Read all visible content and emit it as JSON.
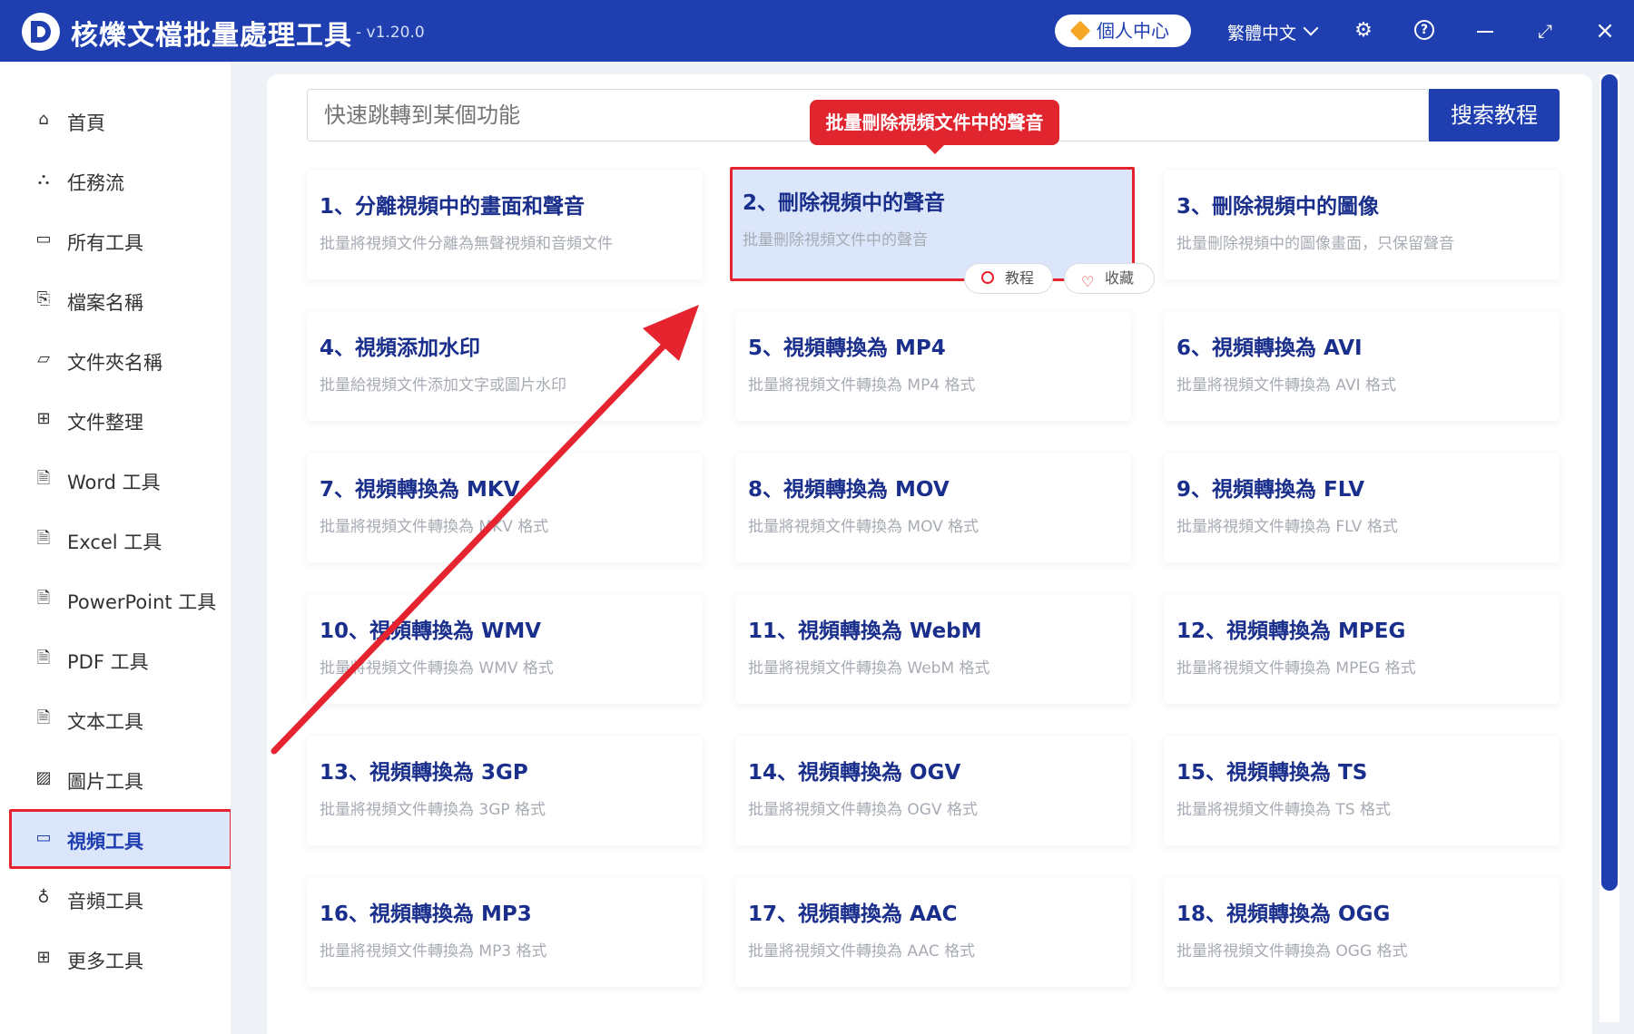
{
  "app": {
    "title": "核爍文檔批量處理工具",
    "version": "- v1.20.0"
  },
  "titlebar": {
    "user_center": "個人中心",
    "language": "繁體中文",
    "icons": [
      "diamond-icon",
      "chevron-down-icon",
      "gear-icon",
      "help-icon",
      "minimize-icon",
      "expand-icon",
      "close-icon"
    ]
  },
  "sidebar": {
    "items": [
      {
        "label": "首頁",
        "icon": "home-icon",
        "glyph": "⌂"
      },
      {
        "label": "任務流",
        "icon": "workflow-icon",
        "glyph": "⛬"
      },
      {
        "label": "所有工具",
        "icon": "monitor-icon",
        "glyph": "▭"
      },
      {
        "label": "檔案名稱",
        "icon": "file-copy-icon",
        "glyph": "⎘"
      },
      {
        "label": "文件夾名稱",
        "icon": "folder-icon",
        "glyph": "▱"
      },
      {
        "label": "文件整理",
        "icon": "organize-icon",
        "glyph": "⊞"
      },
      {
        "label": "Word 工具",
        "icon": "word-icon",
        "glyph": "🗎"
      },
      {
        "label": "Excel 工具",
        "icon": "excel-icon",
        "glyph": "🗎"
      },
      {
        "label": "PowerPoint 工具",
        "icon": "powerpoint-icon",
        "glyph": "🗎"
      },
      {
        "label": "PDF 工具",
        "icon": "pdf-icon",
        "glyph": "🗎"
      },
      {
        "label": "文本工具",
        "icon": "text-icon",
        "glyph": "🗎"
      },
      {
        "label": "圖片工具",
        "icon": "image-icon",
        "glyph": "▨"
      },
      {
        "label": "視頻工具",
        "icon": "video-icon",
        "glyph": "▭",
        "active": true
      },
      {
        "label": "音頻工具",
        "icon": "microphone-icon",
        "glyph": "♁"
      },
      {
        "label": "更多工具",
        "icon": "grid-icon",
        "glyph": "⊞"
      }
    ]
  },
  "search": {
    "placeholder": "快速跳轉到某個功能",
    "button": "搜索教程"
  },
  "tooltip": "批量刪除視頻文件中的聲音",
  "card_actions": {
    "tutorial": "教程",
    "favorite": "收藏"
  },
  "cards": [
    {
      "title": "1、分離視頻中的畫面和聲音",
      "desc": "批量將視頻文件分離為無聲視頻和音頻文件"
    },
    {
      "title": "2、刪除視頻中的聲音",
      "desc": "批量刪除視頻文件中的聲音",
      "highlight": true
    },
    {
      "title": "3、刪除視頻中的圖像",
      "desc": "批量刪除視頻中的圖像畫面，只保留聲音"
    },
    {
      "title": "4、視頻添加水印",
      "desc": "批量給視頻文件添加文字或圖片水印"
    },
    {
      "title": "5、視頻轉換為 MP4",
      "desc": "批量將視頻文件轉換為 MP4 格式"
    },
    {
      "title": "6、視頻轉換為 AVI",
      "desc": "批量將視頻文件轉換為 AVI 格式"
    },
    {
      "title": "7、視頻轉換為 MKV",
      "desc": "批量將視頻文件轉換為 MKV 格式"
    },
    {
      "title": "8、視頻轉換為 MOV",
      "desc": "批量將視頻文件轉換為 MOV 格式"
    },
    {
      "title": "9、視頻轉換為 FLV",
      "desc": "批量將視頻文件轉換為 FLV 格式"
    },
    {
      "title": "10、視頻轉換為 WMV",
      "desc": "批量將視頻文件轉換為 WMV 格式"
    },
    {
      "title": "11、視頻轉換為 WebM",
      "desc": "批量將視頻文件轉換為 WebM 格式"
    },
    {
      "title": "12、視頻轉換為 MPEG",
      "desc": "批量將視頻文件轉換為 MPEG 格式"
    },
    {
      "title": "13、視頻轉換為 3GP",
      "desc": "批量將視頻文件轉換為 3GP 格式"
    },
    {
      "title": "14、視頻轉換為 OGV",
      "desc": "批量將視頻文件轉換為 OGV 格式"
    },
    {
      "title": "15、視頻轉換為 TS",
      "desc": "批量將視頻文件轉換為 TS 格式"
    },
    {
      "title": "16、視頻轉換為 MP3",
      "desc": "批量將視頻文件轉換為 MP3 格式"
    },
    {
      "title": "17、視頻轉換為 AAC",
      "desc": "批量將視頻文件轉換為 AAC 格式"
    },
    {
      "title": "18、視頻轉換為 OGG",
      "desc": "批量將視頻文件轉換為 OGG 格式"
    }
  ],
  "colors": {
    "brand": "#1f3fb0",
    "highlight_border": "#e5242f",
    "active_bg": "#dbe6fb",
    "card_title": "#1a2f8c"
  }
}
